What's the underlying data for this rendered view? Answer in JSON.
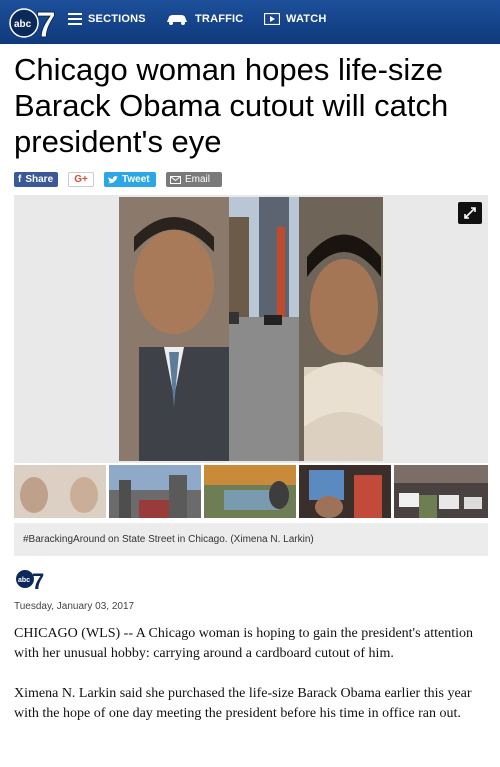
{
  "nav": {
    "logo_text": "abc",
    "logo_number": "7",
    "sections_label": "SECTIONS",
    "traffic_label": "TRAFFIC",
    "watch_label": "WATCH"
  },
  "article": {
    "headline": "Chicago woman hopes life-size Barack Obama cutout will catch president's eye",
    "caption": "#BarackingAround on State Street in Chicago. (Ximena N. Larkin)",
    "date": "Tuesday, January 03, 2017",
    "paragraphs": [
      "CHICAGO (WLS) -- A Chicago woman is hoping to gain the president's attention with her unusual hobby: carrying around a cardboard cutout of him.",
      "Ximena N. Larkin said she purchased the life-size Barack Obama earlier this year with the hope of one day meeting the president before his time in office ran out."
    ]
  },
  "share": {
    "facebook": "Share",
    "google": "G+",
    "twitter": "Tweet",
    "email": "Email"
  },
  "colors": {
    "nav_bg": "#1d4f9a",
    "facebook": "#3b5998",
    "twitter": "#2ca6e6",
    "email": "#7a7a7a"
  }
}
